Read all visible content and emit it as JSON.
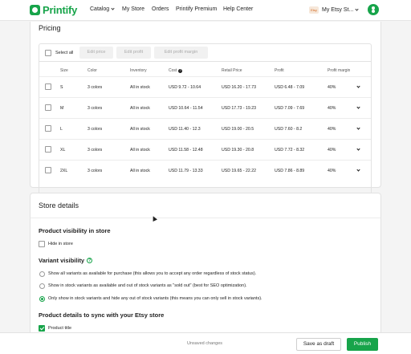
{
  "header": {
    "logo": "Printify",
    "nav": [
      {
        "label": "Catalog",
        "has_dropdown": true
      },
      {
        "label": "My Store",
        "has_dropdown": false
      },
      {
        "label": "Orders",
        "has_dropdown": false
      },
      {
        "label": "Printify Premium",
        "has_dropdown": false
      },
      {
        "label": "Help Center",
        "has_dropdown": false
      }
    ],
    "store_badge": "Etsy",
    "store_name": "My Etsy St...",
    "avatar_icon": "user-icon"
  },
  "pricing": {
    "title": "Pricing",
    "toolbar": {
      "select_all": "Select all",
      "edit_price": "Edit price",
      "edit_profit": "Edit profit",
      "edit_profit_margin": "Edit profit margin"
    },
    "columns": [
      "Size",
      "Color",
      "Inventory",
      "Cost",
      "Retail Price",
      "Profit",
      "Profit margin"
    ],
    "rows": [
      {
        "size": "S",
        "color": "3 colors",
        "inventory": "All in stock",
        "cost": "USD 9.72 - 10.64",
        "retail": "USD 16.20 - 17.73",
        "profit": "USD 6.48 - 7.09",
        "margin": "40%"
      },
      {
        "size": "M",
        "color": "3 colors",
        "inventory": "All in stock",
        "cost": "USD 10.64 - 11.54",
        "retail": "USD 17.73 - 19.23",
        "profit": "USD 7.09 - 7.69",
        "margin": "40%"
      },
      {
        "size": "L",
        "color": "3 colors",
        "inventory": "All in stock",
        "cost": "USD 11.40 - 12.3",
        "retail": "USD 19.00 - 20.5",
        "profit": "USD 7.60 - 8.2",
        "margin": "40%"
      },
      {
        "size": "XL",
        "color": "3 colors",
        "inventory": "All in stock",
        "cost": "USD 11.58 - 12.48",
        "retail": "USD 19.30 - 20.8",
        "profit": "USD 7.72 - 8.32",
        "margin": "40%"
      },
      {
        "size": "2XL",
        "color": "3 colors",
        "inventory": "All in stock",
        "cost": "USD 11.79 - 13.33",
        "retail": "USD 19.65 - 22.22",
        "profit": "USD 7.86 - 8.89",
        "margin": "40%"
      }
    ]
  },
  "store_details": {
    "title": "Store details",
    "product_visibility": {
      "heading": "Product visibility in store",
      "hide_label": "Hide in store",
      "hide_checked": false
    },
    "variant_visibility": {
      "heading": "Variant visibility",
      "options": [
        {
          "label": "Show all variants as available for purchase (this allows you to accept any order regardless of stock status).",
          "selected": false
        },
        {
          "label": "Show in stock variants as available and out of stock variants as \"sold out\" (best for SEO optimization).",
          "selected": false
        },
        {
          "label": "Only show in stock variants and hide any out of stock variants (this means you can only sell in stock variants).",
          "selected": true
        }
      ]
    },
    "sync": {
      "heading": "Product details to sync with your Etsy store",
      "product_title_label": "Product title",
      "product_title_checked": true
    }
  },
  "footer": {
    "status": "Unsaved changes",
    "save_draft": "Save as draft",
    "publish": "Publish"
  },
  "colors": {
    "brand": "#17a44a",
    "background": "#f4f4f4"
  }
}
